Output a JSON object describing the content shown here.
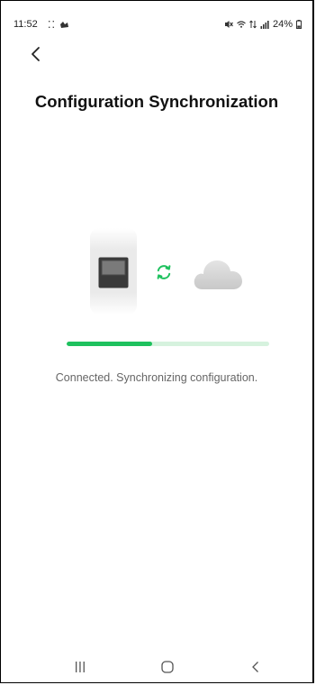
{
  "status_bar": {
    "time": "11:52",
    "notification_glyphs": "⁚⁚",
    "battery": "24%"
  },
  "header": {
    "back_icon": "chevron-left-icon",
    "title": "Configuration Synchronization"
  },
  "sync_visual": {
    "device_icon": "device-panel-icon",
    "sync_icon": "sync-arrows-icon",
    "cloud_icon": "cloud-icon",
    "accent_color": "#1ec15e"
  },
  "progress": {
    "fraction": 0.42
  },
  "message": "Connected. Synchronizing configuration.",
  "nav": {
    "recents_icon": "recents-icon",
    "home_icon": "home-icon",
    "back_icon": "back-icon"
  }
}
